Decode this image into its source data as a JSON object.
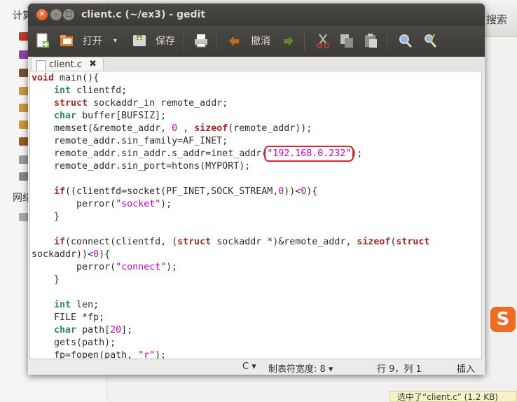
{
  "background": {
    "sidebar_heading_computer": "计算",
    "sidebar_heading_network": "网络",
    "search_label": "搜索",
    "status_popup": "选中了“client.c” (1.2 KB)"
  },
  "window": {
    "title": "client.c (~/ex3) - gedit"
  },
  "toolbar": {
    "open_label": "打开",
    "save_label": "保存",
    "undo_label": "撤消"
  },
  "tab": {
    "label": "client.c",
    "close_glyph": "✖"
  },
  "editor": {
    "highlighted_ip": "\"192.168.0.232\"",
    "lines": [
      "void main(){",
      "    int clientfd;",
      "    struct sockaddr_in remote_addr;",
      "    char buffer[BUFSIZ];",
      "    memset(&remote_addr, 0 , sizeof(remote_addr));",
      "    remote_addr.sin_family=AF_INET;",
      "    remote_addr.sin_addr.s_addr=inet_addr(\"192.168.0.232\");",
      "    remote_addr.sin_port=htons(MYPORT);",
      "",
      "    if((clientfd=socket(PF_INET,SOCK_STREAM,0))<0){",
      "        perror(\"socket\");",
      "    }",
      "",
      "    if(connect(clientfd, (struct sockaddr *)&remote_addr, sizeof(struct",
      "sockaddr))<0){",
      "        perror(\"connect\");",
      "    }",
      "",
      "    int len;",
      "    FILE *fp;",
      "    char path[20];",
      "    gets(path);",
      "    fp=fopen(path, \"r\");"
    ]
  },
  "statusbar": {
    "language": "C ▾",
    "tab_width": "制表符宽度: 8 ▾",
    "position": "行 9，列 1",
    "mode": "插入"
  },
  "colors": {
    "keyword": "#a52a2a",
    "type": "#2e8b57",
    "string": "#c800c8",
    "highlight_box": "#e0202a"
  }
}
